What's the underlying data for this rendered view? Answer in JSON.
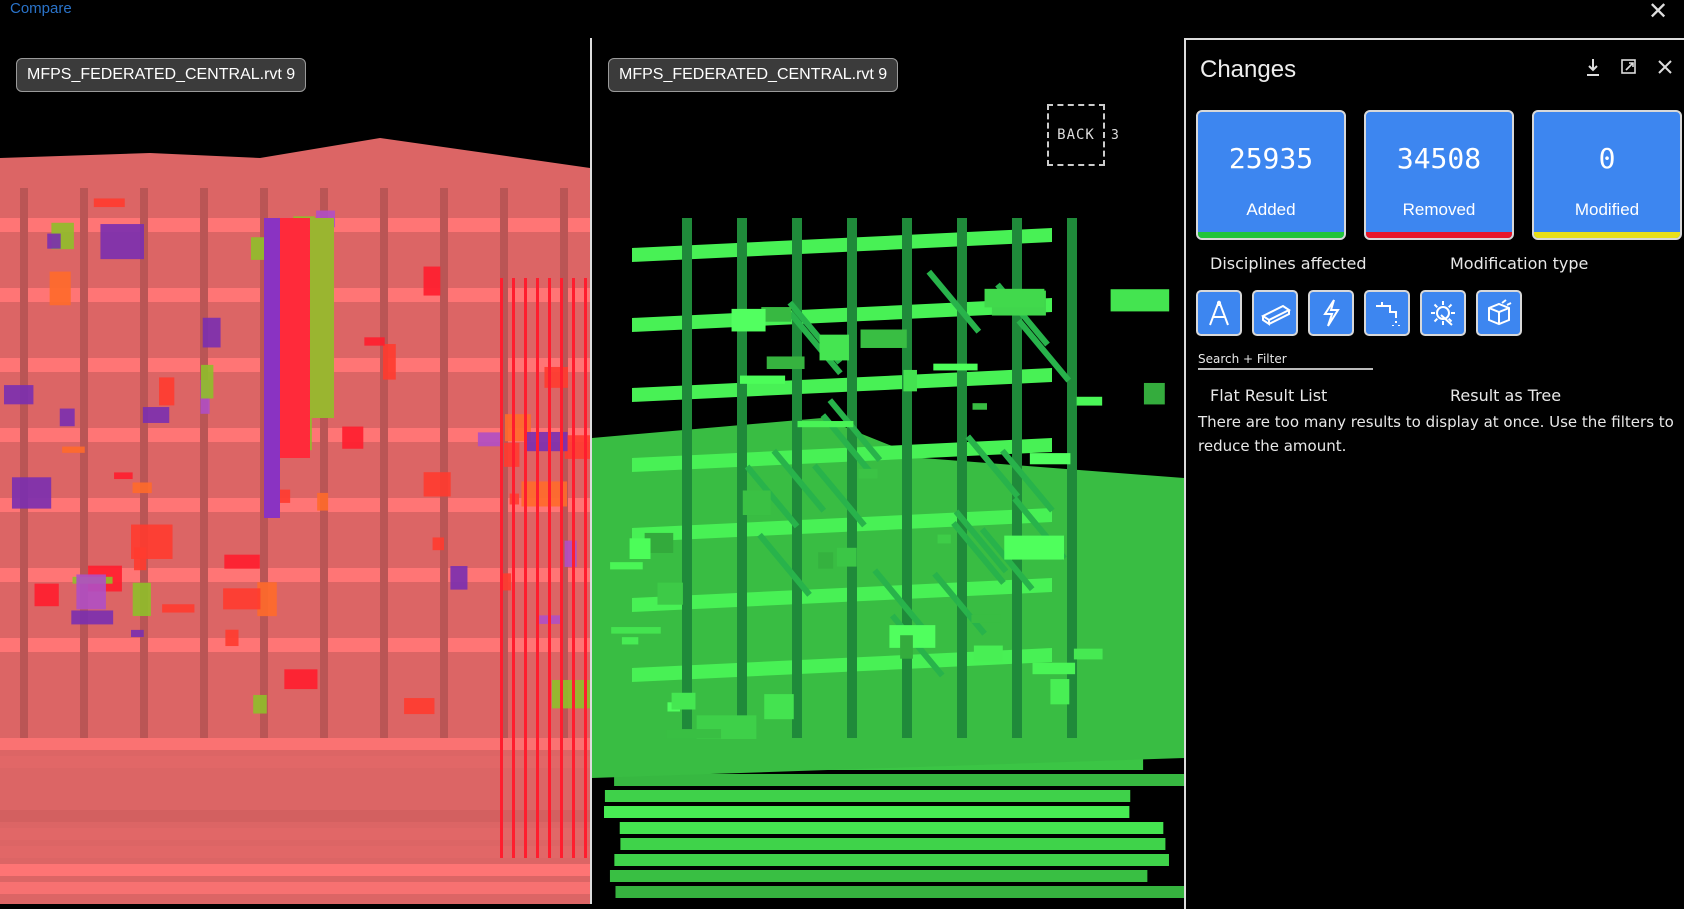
{
  "window": {
    "title": "Compare",
    "close_glyph": "✕"
  },
  "viewports": {
    "left": {
      "model_label": "MFPS_FEDERATED_CENTRAL.rvt 9",
      "render_color": "#e86a6a",
      "accent_color": "#ff1d2e"
    },
    "right": {
      "model_label": "MFPS_FEDERATED_CENTRAL.rvt 9",
      "render_color": "#3fd24a",
      "accent_color": "#1f8a3a",
      "viewcube": {
        "face_label": "BACK",
        "side_label": "3"
      }
    }
  },
  "changes_panel": {
    "title": "Changes",
    "icons": [
      "download-icon",
      "popout-icon",
      "close-icon"
    ],
    "summary": [
      {
        "count": "25935",
        "label": "Added",
        "bar_color": "#22c43a"
      },
      {
        "count": "34508",
        "label": "Removed",
        "bar_color": "#e8162a"
      },
      {
        "count": "0",
        "label": "Modified",
        "bar_color": "#e9df18"
      }
    ],
    "section_left": "Disciplines affected",
    "section_right": "Modification type",
    "disciplines": [
      "architecture-icon",
      "structure-icon",
      "electrical-icon",
      "plumbing-icon",
      "mechanical-icon",
      "generic-model-icon"
    ],
    "search_filter_label": "Search + Filter",
    "view_option_flat": "Flat Result List",
    "view_option_tree": "Result as Tree",
    "message": "There are too many results to display at once. Use the filters to reduce the amount."
  }
}
